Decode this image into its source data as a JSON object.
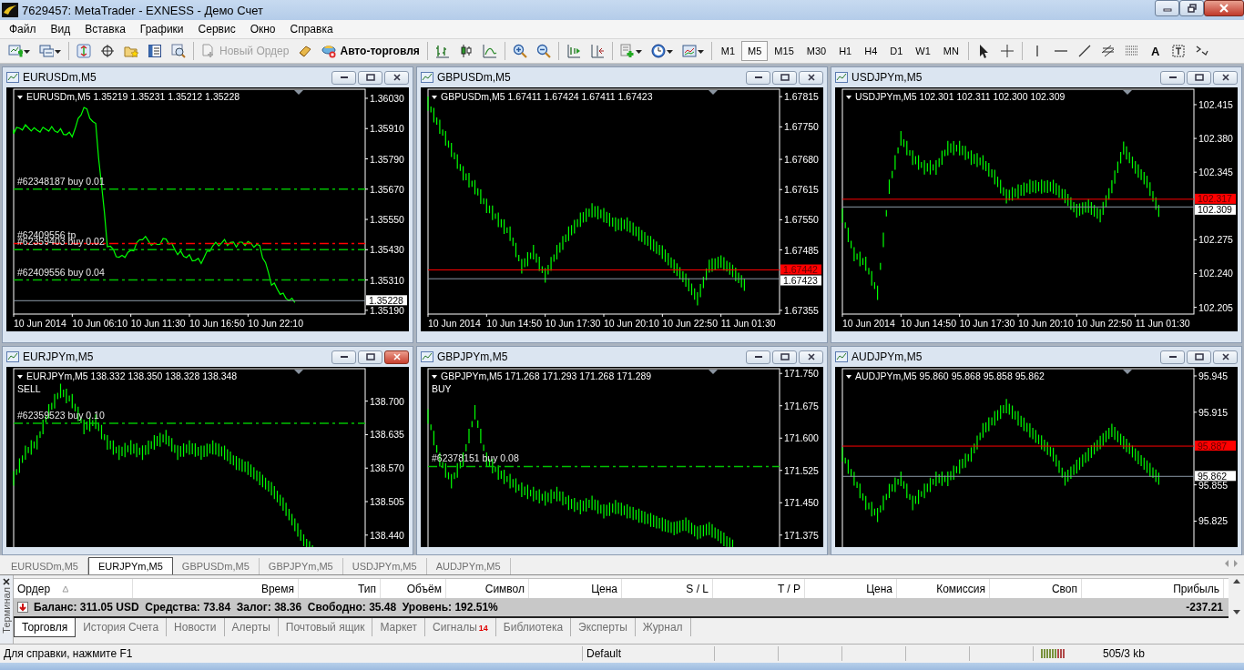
{
  "window": {
    "title": "7629457: MetaTrader - EXNESS - Демо Счет"
  },
  "menu": [
    "Файл",
    "Вид",
    "Вставка",
    "Графики",
    "Сервис",
    "Окно",
    "Справка"
  ],
  "toolbar": {
    "new_order": {
      "label": "Новый Ордер",
      "disabled": true
    },
    "autotrading": {
      "label": "Авто-торговля"
    },
    "timeframes": [
      {
        "label": "M1",
        "selected": false
      },
      {
        "label": "M5",
        "selected": true
      },
      {
        "label": "M15",
        "selected": false
      },
      {
        "label": "M30",
        "selected": false
      },
      {
        "label": "H1",
        "selected": false
      },
      {
        "label": "H4",
        "selected": false
      },
      {
        "label": "D1",
        "selected": false
      },
      {
        "label": "W1",
        "selected": false
      },
      {
        "label": "MN",
        "selected": false
      }
    ],
    "text_tool": "A"
  },
  "charts": [
    {
      "title": "EURUSDm,M5",
      "active": false,
      "header": "EURUSDm,M5  1.35219 1.35231 1.35212 1.35228",
      "price_labels": [
        "1.36030",
        "1.35910",
        "1.35790",
        "1.35670",
        "1.35550",
        "1.35430",
        "1.35310",
        "1.35190"
      ],
      "time_labels": [
        "10 Jun 2014",
        "10 Jun 06:10",
        "10 Jun 11:30",
        "10 Jun 16:50",
        "10 Jun 22:10"
      ],
      "order_lines": [
        {
          "text": "#62348187 buy 0.01",
          "kind": "order"
        },
        {
          "text": "#62409556 tp",
          "kind": "take_profit"
        },
        {
          "text": "#62359403 buy 0.02",
          "kind": "order"
        },
        {
          "text": "#62409556 buy 0.04",
          "kind": "order"
        }
      ],
      "price_tags": [
        {
          "label": "1.35228",
          "color": "#ffffff"
        }
      ]
    },
    {
      "title": "GBPUSDm,M5",
      "active": false,
      "header": "GBPUSDm,M5  1.67411 1.67424 1.67411 1.67423",
      "price_labels": [
        "1.67815",
        "1.67750",
        "1.67680",
        "1.67615",
        "1.67550",
        "1.67485",
        "1.67355"
      ],
      "time_labels": [
        "10 Jun 2014",
        "10 Jun 14:50",
        "10 Jun 17:30",
        "10 Jun 20:10",
        "10 Jun 22:50",
        "11 Jun 01:30"
      ],
      "price_tags": [
        {
          "label": "1.67442",
          "color": "#ff0000"
        },
        {
          "label": "1.67423",
          "color": "#ffffff"
        }
      ]
    },
    {
      "title": "USDJPYm,M5",
      "active": false,
      "header": "USDJPYm,M5  102.301 102.311 102.300 102.309",
      "price_labels": [
        "102.415",
        "102.380",
        "102.345",
        "102.275",
        "102.240",
        "102.205"
      ],
      "time_labels": [
        "10 Jun 2014",
        "10 Jun 14:50",
        "10 Jun 17:30",
        "10 Jun 20:10",
        "10 Jun 22:50",
        "11 Jun 01:30"
      ],
      "price_tags": [
        {
          "label": "102.317",
          "color": "#ff0000"
        },
        {
          "label": "102.309",
          "color": "#ffffff"
        }
      ]
    },
    {
      "title": "EURJPYm,M5",
      "active": true,
      "header": "EURJPYm,M5  138.332 138.350 138.328 138.348",
      "signal": "SELL",
      "price_labels": [
        "138.700",
        "138.635",
        "138.570",
        "138.505",
        "138.440"
      ],
      "order_lines": [
        {
          "text": "#62359523 buy 0.10",
          "kind": "order"
        }
      ]
    },
    {
      "title": "GBPJPYm,M5",
      "active": false,
      "header": "GBPJPYm,M5  171.268 171.293 171.268 171.289",
      "signal": "BUY",
      "price_labels": [
        "171.750",
        "171.675",
        "171.600",
        "171.525",
        "171.450",
        "171.375"
      ],
      "order_lines": [
        {
          "text": "#62378151 buy 0.08",
          "kind": "order"
        }
      ]
    },
    {
      "title": "AUDJPYm,M5",
      "active": false,
      "header": "AUDJPYm,M5  95.860 95.868 95.858 95.862",
      "price_labels": [
        "95.945",
        "95.915",
        "95.855",
        "95.825"
      ],
      "price_tags": [
        {
          "label": "95.887",
          "color": "#ff0000"
        },
        {
          "label": "95.862",
          "color": "#ffffff"
        }
      ]
    }
  ],
  "chart_tabs": [
    {
      "label": "EURUSDm,M5",
      "selected": false
    },
    {
      "label": "EURJPYm,M5",
      "selected": true
    },
    {
      "label": "GBPUSDm,M5",
      "selected": false
    },
    {
      "label": "GBPJPYm,M5",
      "selected": false
    },
    {
      "label": "USDJPYm,M5",
      "selected": false
    },
    {
      "label": "AUDJPYm,M5",
      "selected": false
    }
  ],
  "terminal": {
    "side_label": "Терминал",
    "columns": [
      "Ордер",
      "Время",
      "Тип",
      "Объём",
      "Символ",
      "Цена",
      "S / L",
      "T / P",
      "Цена",
      "Комиссия",
      "Своп",
      "Прибыль"
    ],
    "summary": "Баланс: 311.05 USD  Средства: 73.84  Залог: 38.36  Свободно: 35.48  Уровень: 192.51%",
    "profit": "-237.21",
    "tabs": [
      {
        "label": "Торговля",
        "selected": true
      },
      {
        "label": "История Счета",
        "selected": false
      },
      {
        "label": "Новости",
        "selected": false
      },
      {
        "label": "Алерты",
        "selected": false
      },
      {
        "label": "Почтовый ящик",
        "selected": false
      },
      {
        "label": "Маркет",
        "selected": false
      },
      {
        "label": "Сигналы",
        "badge": "14",
        "selected": false
      },
      {
        "label": "Библиотека",
        "selected": false
      },
      {
        "label": "Эксперты",
        "selected": false
      },
      {
        "label": "Журнал",
        "selected": false
      }
    ]
  },
  "status_bar": {
    "help": "Для справки, нажмите F1",
    "profile": "Default",
    "traffic": "505/3 kb"
  }
}
